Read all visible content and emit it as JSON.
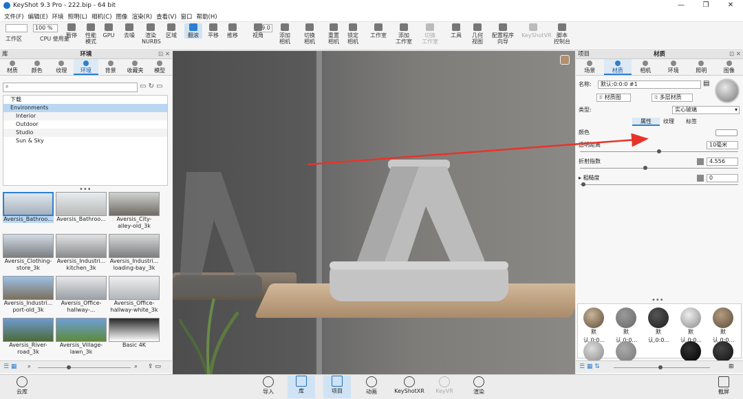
{
  "app": {
    "title": "KeyShot 9.3 Pro  - 222.bip  - 64 bit",
    "win_min": "—",
    "win_max": "❐",
    "win_close": "✕"
  },
  "menu": [
    "文件(F)",
    "编辑(E)",
    "环境",
    "照明(L)",
    "相机(C)",
    "图像",
    "渲染(R)",
    "查看(V)",
    "窗口",
    "帮助(H)"
  ],
  "toolbar": {
    "percent": "100 %",
    "fov": "69.0",
    "items": [
      {
        "label": "工作区"
      },
      {
        "label": "CPU 使用量"
      },
      {
        "label": "暂停"
      },
      {
        "label": "性能\n模式"
      },
      {
        "label": "GPU"
      },
      {
        "label": "去噪"
      },
      {
        "label": "渲染\nNURBS"
      },
      {
        "label": "区域"
      },
      {
        "label": "翻滚",
        "active": true
      },
      {
        "label": "平移"
      },
      {
        "label": "推移"
      },
      {
        "label": "视角"
      },
      {
        "label": "添加\n相机"
      },
      {
        "label": "切换\n相机"
      },
      {
        "label": "重置\n相机"
      },
      {
        "label": "锁定\n相机"
      },
      {
        "label": "工作室"
      },
      {
        "label": "添加\n工作室"
      },
      {
        "label": "切换\n工作室",
        "disabled": true
      },
      {
        "label": "工具"
      },
      {
        "label": "几何\n视图"
      },
      {
        "label": "配置程序\n向导"
      },
      {
        "label": "KeyShotVR",
        "disabled": true
      },
      {
        "label": "脚本\n控制台"
      }
    ]
  },
  "left_panel": {
    "header": "环境",
    "corner": "库",
    "tabs": [
      "材质",
      "颜色",
      "纹理",
      "环境",
      "背景",
      "收藏夹",
      "模型"
    ],
    "search_placeholder": "",
    "tree": [
      "下载",
      "Environments",
      "Interior",
      "Outdoor",
      "Studio",
      "Sun & Sky"
    ],
    "thumbs": [
      "Aversis_Bathroo...",
      "Aversis_Bathroo...",
      "Aversis_City-\nalley-old_3k",
      "Aversis_Clothing-\nstore_3k",
      "Aversis_Industri...\nkitchen_3k",
      "Aversis_Industri...\nloading-bay_3k",
      "Aversis_Industri...\nport-old_3k",
      "Aversis_Office-\nhallway-...",
      "Aversis_Office-\nhallway-white_3k",
      "Aversis_River-\nroad_3k",
      "Aversis_Village-\nlawn_3k",
      "Basic 4K"
    ]
  },
  "right_panel": {
    "header": "材质",
    "corner": "项目",
    "tabs": [
      "场景",
      "材质",
      "相机",
      "环境",
      "照明",
      "图像"
    ],
    "name_label": "名称:",
    "name_value": "默认:0:0:0 #1",
    "btn_graph": "材质图",
    "btn_multi": "多层材质",
    "type_label": "类型:",
    "type_value": "实心玻璃",
    "subtabs": [
      "属性",
      "纹理",
      "标签"
    ],
    "color_label": "颜色",
    "transparency_label": "透明距离",
    "transparency_value": "10毫米",
    "ior_label": "折射指数",
    "ior_value": "4.556",
    "rough_label": "粗糙度",
    "rough_value": "0",
    "materials": [
      "默认,0:0...",
      "默认,0:0...",
      "默认,0:0...",
      "默认,0:0...",
      "默认,0:0..."
    ]
  },
  "bottom": {
    "cloud": "云库",
    "buttons": [
      {
        "label": "导入"
      },
      {
        "label": "库",
        "active": true
      },
      {
        "label": "项目",
        "active": true
      },
      {
        "label": "动画"
      },
      {
        "label": "KeyShotXR"
      },
      {
        "label": "KeyVR",
        "disabled": true
      },
      {
        "label": "渲染"
      }
    ],
    "screenshot": "截屏"
  }
}
